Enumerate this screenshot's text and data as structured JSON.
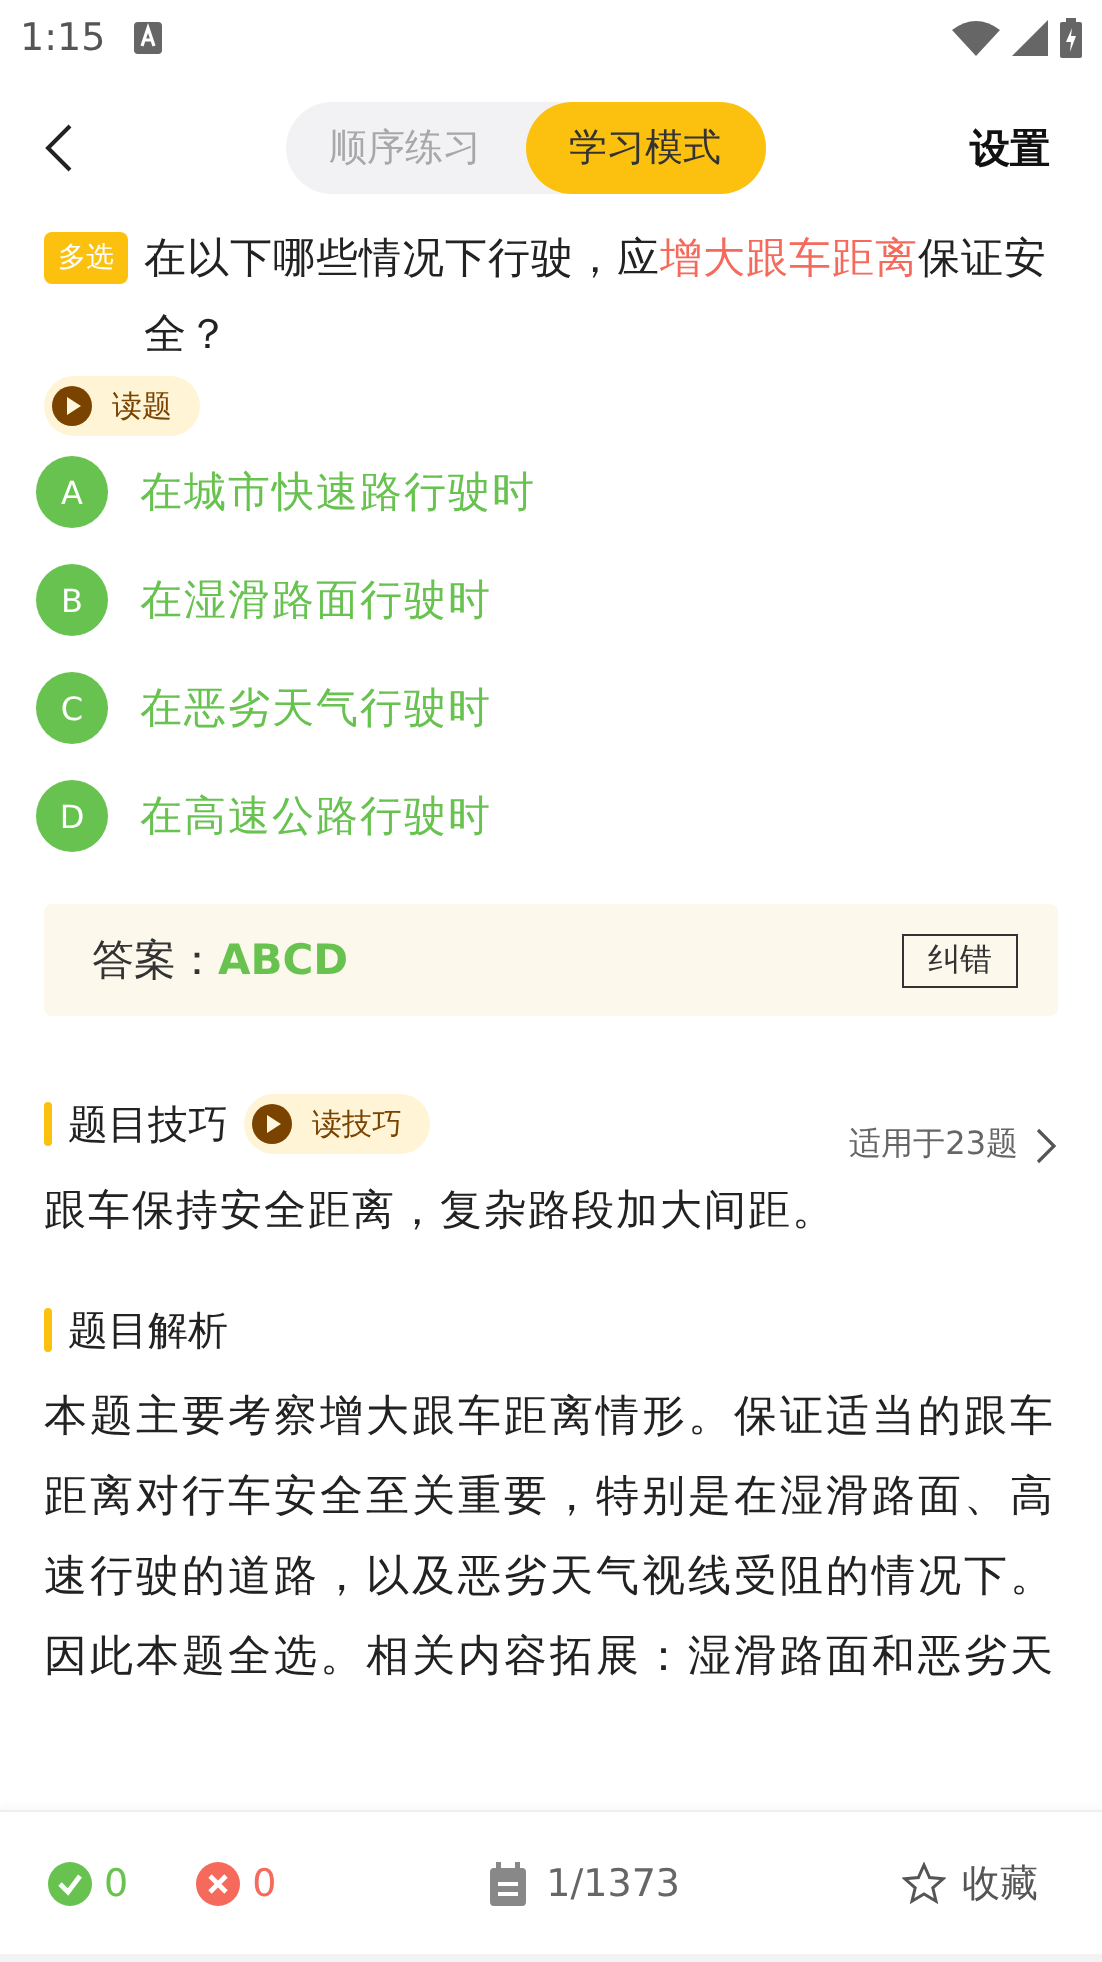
{
  "status_bar": {
    "time": "1:15"
  },
  "nav": {
    "tabs": [
      {
        "label": "顺序练习",
        "selected": false
      },
      {
        "label": "学习模式",
        "selected": true
      }
    ],
    "settings": "设置"
  },
  "question": {
    "tag": "多选",
    "parts": [
      {
        "text": "在以下哪些情况下行驶，应",
        "highlight": false
      },
      {
        "text": "增大跟车距离",
        "highlight": true
      },
      {
        "text": "保证安全？",
        "highlight": false
      }
    ],
    "read_button": "读题"
  },
  "options": [
    {
      "letter": "A",
      "text": "在城市快速路行驶时",
      "selected": true
    },
    {
      "letter": "B",
      "text": "在湿滑路面行驶时",
      "selected": true
    },
    {
      "letter": "C",
      "text": "在恶劣天气行驶时",
      "selected": true
    },
    {
      "letter": "D",
      "text": "在高速公路行驶时",
      "selected": true
    }
  ],
  "answer": {
    "label": "答案：",
    "value": "ABCD",
    "report_button": "纠错"
  },
  "tips": {
    "title": "题目技巧",
    "read_button": "读技巧",
    "applies": "适用于23题",
    "text": "跟车保持安全距离，复杂路段加大间距。"
  },
  "analysis": {
    "title": "题目解析",
    "text": "本题主要考察增大跟车距离情形。保证适当的跟车距离对行车安全至关重要，特别是在湿滑路面、高速行驶的道路，以及恶劣天气视线受阻的情况下。因此本题全选。相关内容拓展：湿滑路面和恶劣天"
  },
  "bottom_bar": {
    "correct": "0",
    "wrong": "0",
    "progress": "1/1373",
    "favorite": "收藏"
  }
}
